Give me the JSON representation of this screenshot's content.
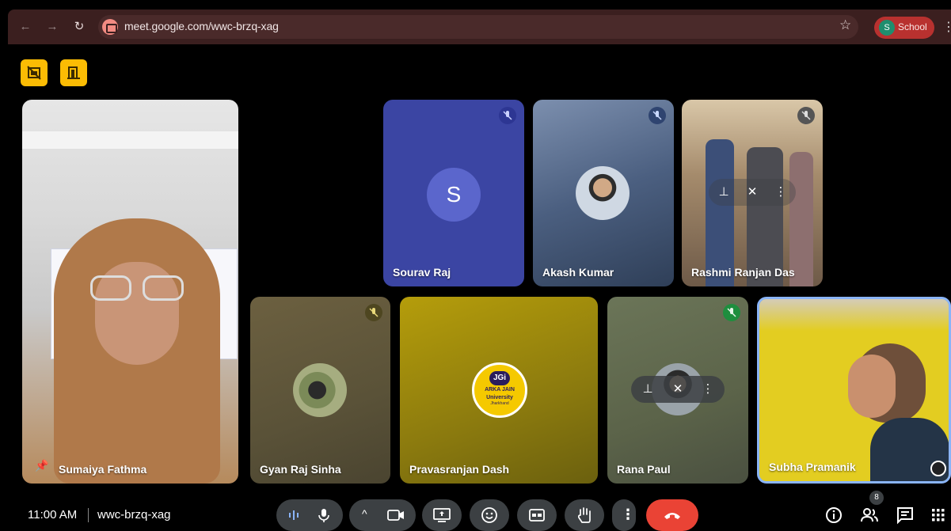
{
  "browser": {
    "url": "meet.google.com/wwc-brzq-xag",
    "profile_initial": "S",
    "profile_label": "School",
    "nav": {
      "back_glyph": "←",
      "forward_glyph": "→",
      "reload_glyph": "↻",
      "star_glyph": "☆",
      "menu_glyph": "⋮"
    }
  },
  "host_controls": [
    {
      "icon": "no-crop-icon"
    },
    {
      "icon": "door-exit-icon"
    }
  ],
  "participants": {
    "sumaiya": {
      "name": "Sumaiya Fathma",
      "pinned": true,
      "muted": false,
      "pin_glyph": "📌"
    },
    "sourav": {
      "name": "Sourav Raj",
      "avatar_letter": "S",
      "muted": true
    },
    "akash": {
      "name": "Akash Kumar",
      "muted": true
    },
    "rashmi": {
      "name": "Rashmi Ranjan Das",
      "muted": true
    },
    "gyan": {
      "name": "Gyan Raj Sinha",
      "muted": true
    },
    "pravas": {
      "name": "Pravasranjan Dash",
      "logo_line1": "JGi",
      "logo_line2": "ARKA JAIN",
      "logo_line3": "University",
      "logo_line4": "Jharkhand"
    },
    "rana": {
      "name": "Rana Paul",
      "muted": true
    },
    "subha": {
      "name": "Subha Pramanik",
      "active_speaker": true
    }
  },
  "bottom_bar": {
    "time": "11:00 AM",
    "separator": "|",
    "meeting_code": "wwc-brzq-xag",
    "people_count": "8",
    "caret": "^",
    "more_glyph": "⋮"
  },
  "colors": {
    "accent_yellow": "#fbbc04",
    "end_call_red": "#ea4335",
    "control_gray": "#3c4043",
    "chrome_bg": "#3b1f1f",
    "active_speaker_border": "#8ab4f8"
  }
}
